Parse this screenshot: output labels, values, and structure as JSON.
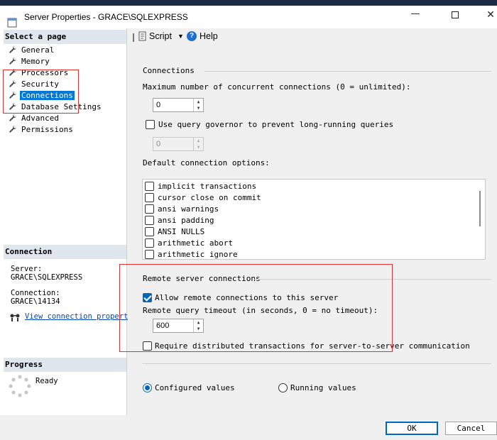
{
  "window": {
    "title": "Server Properties - GRACE\\SQLEXPRESS"
  },
  "select_page": {
    "header": "Select a page",
    "items": [
      {
        "label": "General"
      },
      {
        "label": "Memory"
      },
      {
        "label": "Processors"
      },
      {
        "label": "Security"
      },
      {
        "label": "Connections",
        "selected": true
      },
      {
        "label": "Database Settings"
      },
      {
        "label": "Advanced"
      },
      {
        "label": "Permissions"
      }
    ]
  },
  "connection": {
    "header": "Connection",
    "server_label": "Server:",
    "server_value": "GRACE\\SQLEXPRESS",
    "connection_label": "Connection:",
    "connection_value": "GRACE\\14134",
    "link": "View connection properties"
  },
  "progress": {
    "header": "Progress",
    "status": "Ready"
  },
  "toolbar": {
    "script": "Script",
    "help": "Help"
  },
  "connections": {
    "group_label": "Connections",
    "max_label": "Maximum number of concurrent connections (0 = unlimited):",
    "max_value": "0",
    "governor_label": "Use query governor to prevent long-running queries",
    "governor_checked": false,
    "governor_value": "0",
    "default_options_label": "Default connection options:",
    "options": [
      {
        "label": "implicit transactions",
        "checked": false
      },
      {
        "label": "cursor close on commit",
        "checked": false
      },
      {
        "label": "ansi warnings",
        "checked": false
      },
      {
        "label": "ansi padding",
        "checked": false
      },
      {
        "label": "ANSI NULLS",
        "checked": false
      },
      {
        "label": "arithmetic abort",
        "checked": false
      },
      {
        "label": "arithmetic ignore",
        "checked": false
      }
    ]
  },
  "remote": {
    "group_label": "Remote server connections",
    "allow_label": "Allow remote connections to this server",
    "allow_checked": true,
    "timeout_label": "Remote query timeout (in seconds, 0 = no timeout):",
    "timeout_value": "600",
    "distributed_label": "Require distributed transactions for server-to-server communication",
    "distributed_checked": false
  },
  "values_mode": {
    "configured": "Configured values",
    "running": "Running values",
    "selected": "configured"
  },
  "buttons": {
    "ok": "OK",
    "cancel": "Cancel"
  },
  "colors": {
    "highlight": "#0078d7",
    "annotation": "#e03030",
    "link": "#0645ad"
  }
}
